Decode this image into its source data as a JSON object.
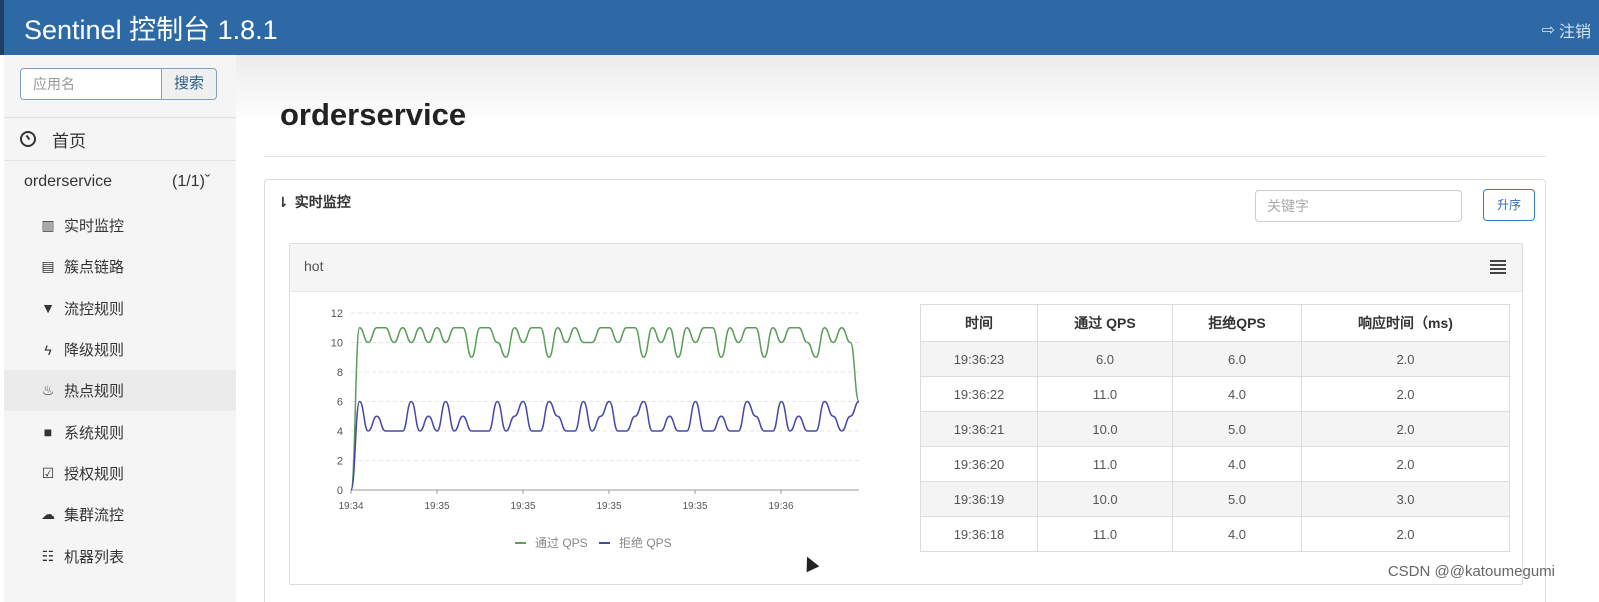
{
  "header": {
    "title": "Sentinel 控制台 1.8.1",
    "logout_label": "注销"
  },
  "sidebar": {
    "search_placeholder": "应用名",
    "search_button": "搜索",
    "home_label": "首页",
    "app_name": "orderservice",
    "app_count": "(1/1)",
    "menu": [
      {
        "label": "实时监控",
        "icon": "bar-chart-icon"
      },
      {
        "label": "簇点链路",
        "icon": "list-icon"
      },
      {
        "label": "流控规则",
        "icon": "filter-icon"
      },
      {
        "label": "降级规则",
        "icon": "flash-icon"
      },
      {
        "label": "热点规则",
        "icon": "fire-icon"
      },
      {
        "label": "系统规则",
        "icon": "lock-icon"
      },
      {
        "label": "授权规则",
        "icon": "check-icon"
      },
      {
        "label": "集群流控",
        "icon": "cloud-icon"
      },
      {
        "label": "机器列表",
        "icon": "table-icon"
      }
    ]
  },
  "main": {
    "page_title": "orderservice",
    "panel_title": "实时监控",
    "keyword_placeholder": "关键字",
    "sort_button": "升序",
    "card_name": "hot",
    "table": {
      "headers": [
        "时间",
        "通过 QPS",
        "拒绝QPS",
        "响应时间（ms)"
      ],
      "rows": [
        [
          "19:36:23",
          "6.0",
          "6.0",
          "2.0"
        ],
        [
          "19:36:22",
          "11.0",
          "4.0",
          "2.0"
        ],
        [
          "19:36:21",
          "10.0",
          "5.0",
          "2.0"
        ],
        [
          "19:36:20",
          "11.0",
          "4.0",
          "2.0"
        ],
        [
          "19:36:19",
          "10.0",
          "5.0",
          "3.0"
        ],
        [
          "19:36:18",
          "11.0",
          "4.0",
          "2.0"
        ]
      ]
    }
  },
  "chart_data": {
    "type": "line",
    "x_ticks": [
      "19:34",
      "19:35",
      "19:35",
      "19:35",
      "19:35",
      "19:36"
    ],
    "ylim": [
      0,
      12
    ],
    "y_ticks": [
      0,
      2,
      4,
      6,
      8,
      10,
      12
    ],
    "series": [
      {
        "name": "通过 QPS",
        "color": "#5a9e5a",
        "values": [
          0,
          11,
          10,
          11,
          11,
          10,
          11,
          10,
          11,
          10,
          11,
          10,
          11,
          11,
          9,
          11,
          11,
          10,
          9,
          11,
          10,
          11,
          11,
          9,
          11,
          10,
          11,
          10,
          10,
          11,
          11,
          10,
          11,
          11,
          9,
          11,
          10,
          11,
          9,
          11,
          10,
          11,
          11,
          9,
          11,
          10,
          11,
          11,
          9,
          11,
          10,
          11,
          11,
          10,
          9,
          11,
          10,
          11,
          10,
          6
        ]
      },
      {
        "name": "拒绝 QPS",
        "color": "#4848a8",
        "values": [
          0,
          6,
          4,
          5,
          4,
          4,
          4,
          6,
          4,
          5,
          4,
          6,
          4,
          5,
          4,
          4,
          4,
          6,
          4,
          5,
          6,
          4,
          4,
          6,
          5,
          4,
          4,
          6,
          4,
          5,
          6,
          4,
          4,
          5,
          6,
          4,
          4,
          5,
          4,
          4,
          6,
          4,
          4,
          5,
          4,
          4,
          6,
          5,
          4,
          4,
          6,
          4,
          5,
          4,
          4,
          6,
          5,
          4,
          5,
          6
        ]
      }
    ]
  },
  "watermark": "CSDN @@katoumegumi"
}
